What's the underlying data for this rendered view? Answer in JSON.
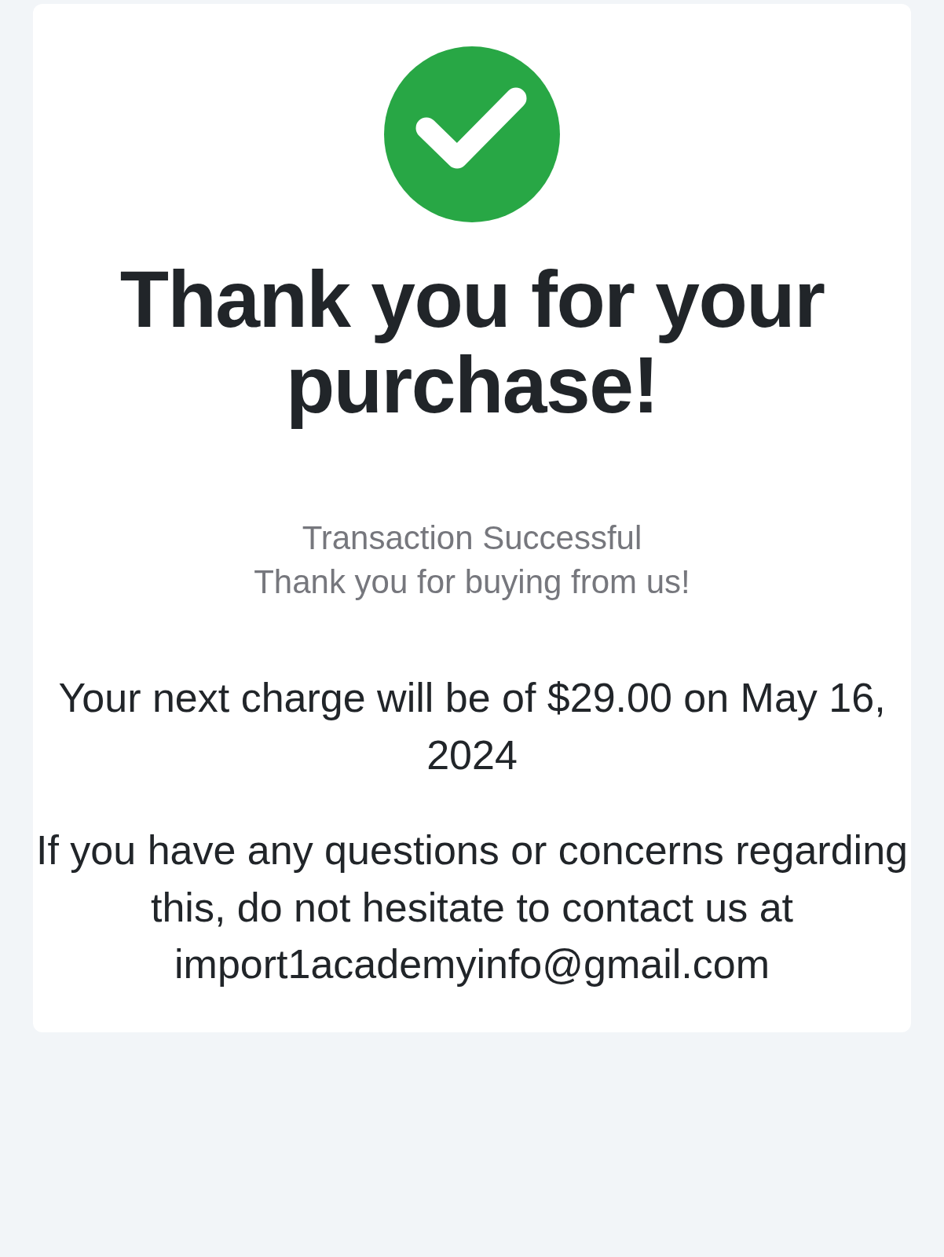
{
  "heading": "Thank you for your purchase!",
  "status": {
    "title": "Transaction Successful",
    "message": "Thank you for buying from us!"
  },
  "paragraphs": [
    "Your next charge will be of $29.00 on May 16, 2024",
    "If you have any questions or concerns regarding this, do not hesitate to contact us at import1academyinfo@gmail.com"
  ]
}
